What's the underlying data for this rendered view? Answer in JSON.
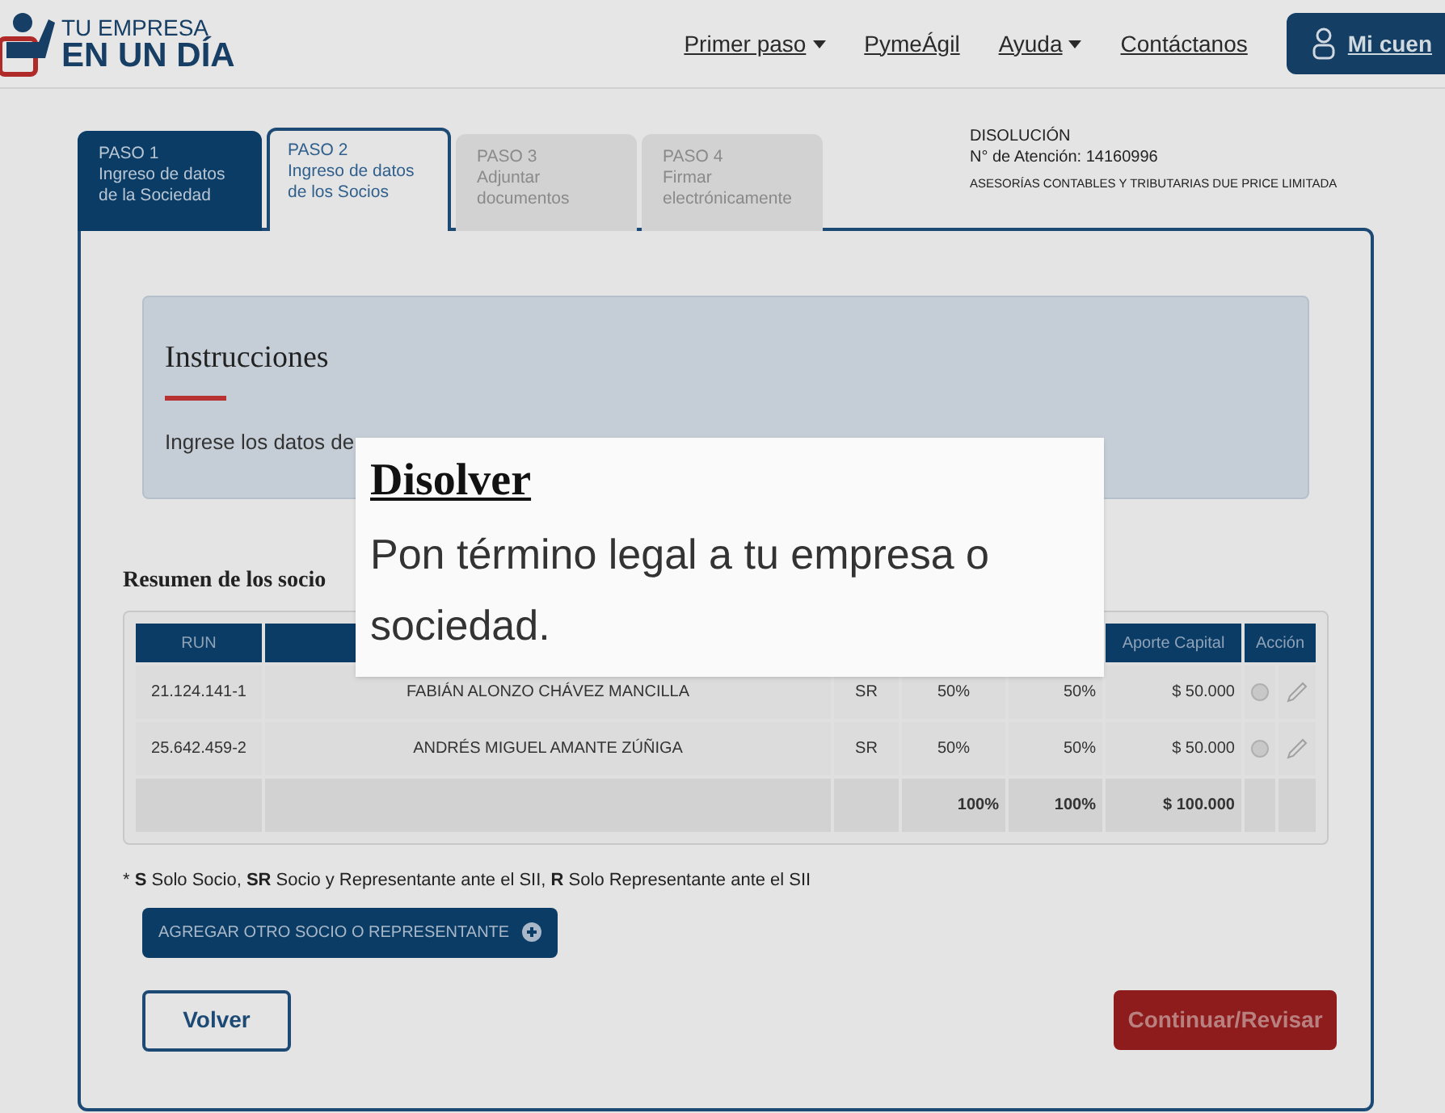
{
  "header": {
    "logo_top": "TU EMPRESA",
    "logo_bottom": "EN UN DÍA",
    "nav": [
      {
        "label": "Primer paso",
        "dropdown": true
      },
      {
        "label": "PymeÁgil",
        "dropdown": false
      },
      {
        "label": "Ayuda",
        "dropdown": true
      },
      {
        "label": "Contáctanos",
        "dropdown": false
      }
    ],
    "account": "Mi cuen"
  },
  "steps": [
    {
      "step": "PASO 1",
      "label": "Ingreso de datos de la Sociedad",
      "selected": false,
      "completed": true
    },
    {
      "step": "PASO 2",
      "label": "Ingreso de datos de los Socios",
      "selected": true,
      "completed": false
    },
    {
      "step": "PASO 3",
      "label": "Adjuntar documentos",
      "selected": false,
      "completed": false
    },
    {
      "step": "PASO 4",
      "label": "Firmar electrónicamente",
      "selected": false,
      "completed": false
    }
  ],
  "info": {
    "type": "DISOLUCIÓN",
    "attention": "N° de Atención: 14160996",
    "company": "ASESORÍAS CONTABLES Y TRIBUTARIAS DUE PRICE LIMITADA"
  },
  "instructions": {
    "title": "Instrucciones",
    "text": "Ingrese los datos de"
  },
  "summary_title": "Resumen de los socio",
  "table": {
    "columns": {
      "run": "RUN",
      "capital": "Aporte Capital",
      "action": "Acción"
    },
    "rows": [
      {
        "run": "21.124.141-1",
        "name": "FABIÁN ALONZO CHÁVEZ MANCILLA",
        "type": "SR",
        "pct_1": "50%",
        "pct_2": "50%",
        "capital": "$ 50.000"
      },
      {
        "run": "25.642.459-2",
        "name": "ANDRÉS MIGUEL AMANTE ZÚÑIGA",
        "type": "SR",
        "pct_1": "50%",
        "pct_2": "50%",
        "capital": "$ 50.000"
      }
    ],
    "totals": {
      "pct_1": "100%",
      "pct_2": "100%",
      "capital": "$ 100.000"
    }
  },
  "legend": "* **S** Solo Socio, **SR** Socio y Representante ante el SII, **R** Solo Representante ante el SII",
  "add_button": "AGREGAR OTRO SOCIO O REPRESENTANTE",
  "back_button": "Volver",
  "continue_button": "Continuar/Revisar",
  "popup": {
    "title": "Disolver",
    "text": "Pon término legal a tu empresa o sociedad."
  }
}
